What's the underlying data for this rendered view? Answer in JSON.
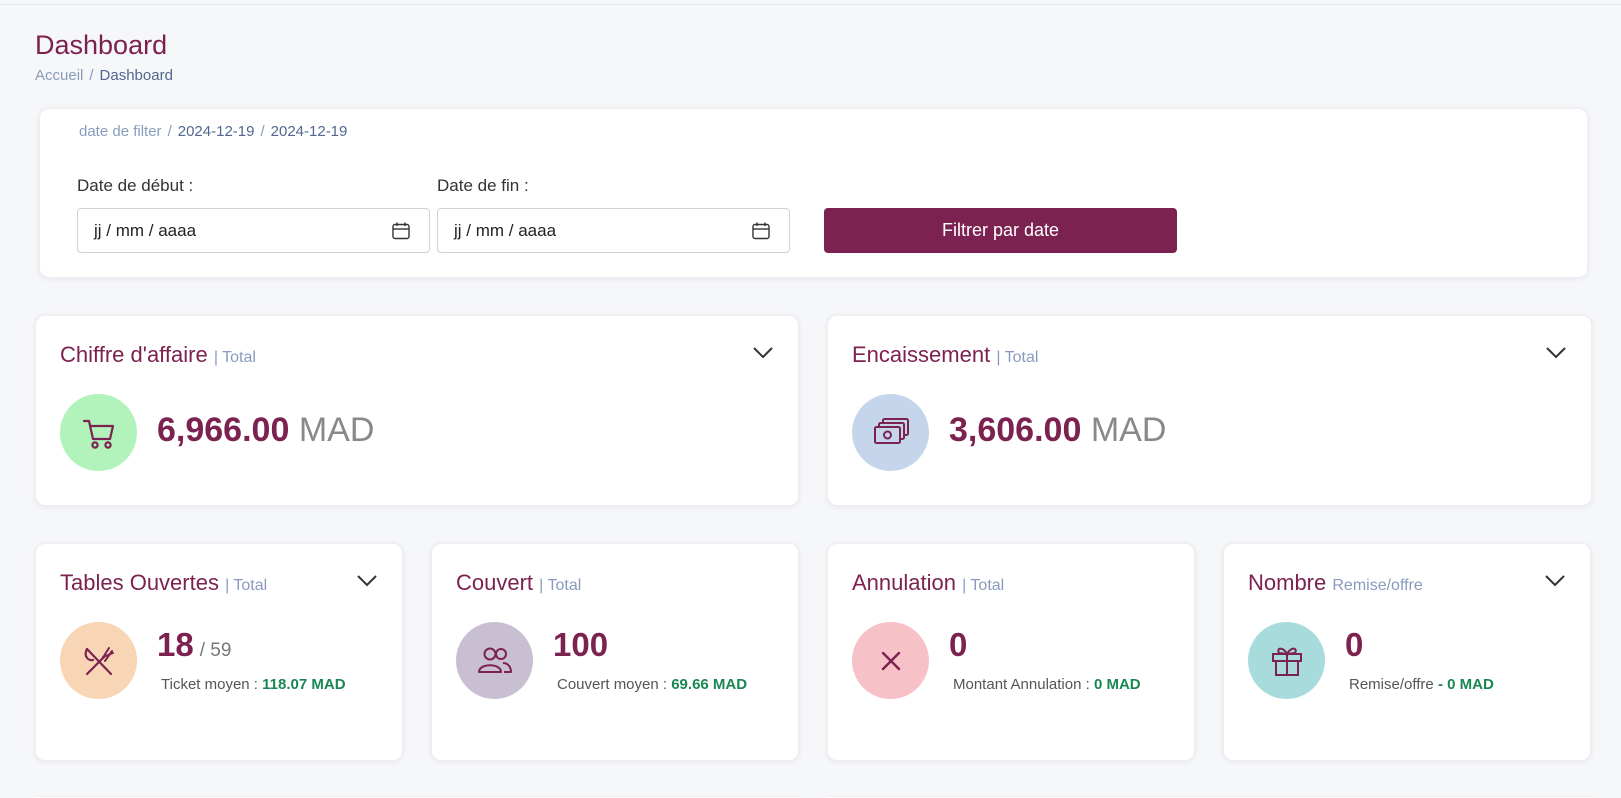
{
  "page": {
    "title": "Dashboard",
    "breadcrumb": {
      "home": "Accueil",
      "separator": "/",
      "current": "Dashboard"
    }
  },
  "filter": {
    "crumb_label": "date de filter",
    "separator": "/",
    "date_start_shown": "2024-12-19",
    "date_end_shown": "2024-12-19",
    "start_label": "Date de début :",
    "end_label": "Date de fin :",
    "start_value": "jj / mm / aaaa",
    "end_value": "jj / mm / aaaa",
    "button_label": "Filtrer par date"
  },
  "cards": {
    "chiffre": {
      "title": "Chiffre d'affaire",
      "sub": "| Total",
      "value": "6,966.00",
      "unit": "MAD",
      "icon": "cart-icon",
      "icon_bg": "#b2f2bb"
    },
    "encaissement": {
      "title": "Encaissement",
      "sub": "| Total",
      "value": "3,606.00",
      "unit": "MAD",
      "icon": "cash-icon",
      "icon_bg": "#c5d6ec"
    },
    "tables": {
      "title": "Tables Ouvertes",
      "sub": "| Total",
      "value": "18",
      "of": "/ 59",
      "detail_label": "Ticket moyen :",
      "detail_value": "118.07 MAD",
      "icon": "cutlery-icon",
      "icon_bg": "#f7d5b5"
    },
    "couvert": {
      "title": "Couvert",
      "sub": "| Total",
      "value": "100",
      "detail_label": "Couvert moyen :",
      "detail_value": "69.66 MAD",
      "icon": "people-icon",
      "icon_bg": "#c9bfd3"
    },
    "annulation": {
      "title": "Annulation",
      "sub": "| Total",
      "value": "0",
      "detail_label": "Montant Annulation :",
      "detail_value": "0 MAD",
      "icon": "close-icon",
      "icon_bg": "#f6c1c7"
    },
    "nombre": {
      "title": "Nombre",
      "sub": "Remise/offre",
      "value": "0",
      "detail_label": "Remise/offre",
      "detail_value": "- 0 MAD",
      "icon": "gift-icon",
      "icon_bg": "#a8dcdc"
    }
  },
  "colors": {
    "brand": "#7c2250",
    "muted": "#899bbd",
    "positive": "#198754"
  }
}
